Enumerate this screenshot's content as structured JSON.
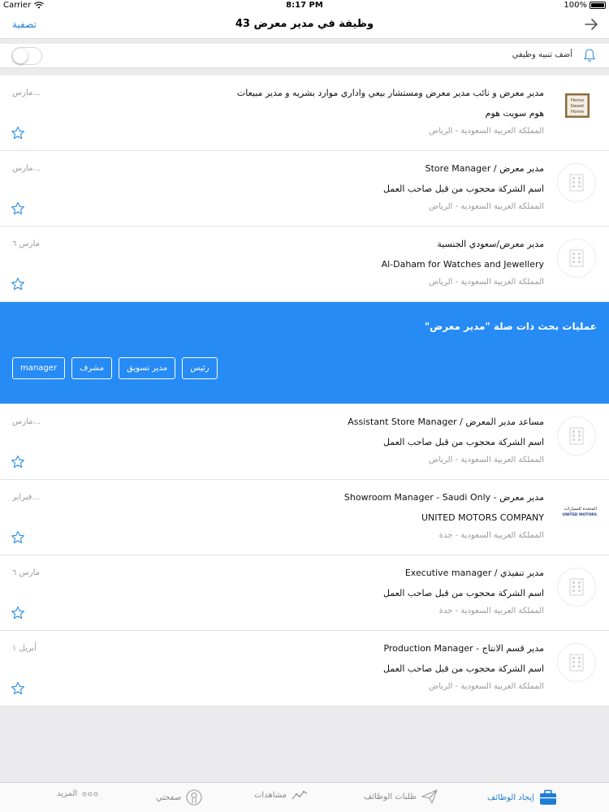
{
  "status": {
    "carrier": "Carrier",
    "time": "8:17 PM",
    "battery": "100%"
  },
  "nav": {
    "filter_label": "تصفية",
    "title": "43 وظيفة في مدير معرض"
  },
  "alert": {
    "label": "أضف تنبيه وظيفي",
    "enabled": false
  },
  "jobs_top": [
    {
      "title": "مدير معرض  و نائب مدير معرض  ومستشار بيعي  واداري موارد بشريه و مدير مبيعات",
      "company": "هوم سويت هوم",
      "location": "المملكة العربية السعودية - الرياض",
      "date": "مارس...",
      "logo": "home-sweet-home-logo"
    },
    {
      "title": "مدير معرض / Store Manager",
      "company": "اسم الشركة محجوب من قبل صاحب العمل",
      "location": "المملكة العربية السعودية - الرياض",
      "date": "مارس...",
      "logo": "building-placeholder-icon"
    },
    {
      "title": "مدير معرض/سعودي الجنسية",
      "company": "Al-Daham for Watches and Jewellery",
      "location": "المملكة العربية السعودية - الرياض",
      "date": "مارس ٦",
      "logo": "building-placeholder-icon"
    }
  ],
  "related": {
    "title": "عمليات بحث ذات صلة \"مدير معرض\"",
    "chips": [
      "manager",
      "مشرف",
      "مدير تسويق",
      "رئيس"
    ]
  },
  "jobs_bottom": [
    {
      "title": "مساعد مدير المعرض / Assistant Store Manager",
      "company": "اسم الشركة محجوب من قبل صاحب العمل",
      "location": "المملكة العربية السعودية - الرياض",
      "date": "مارس...",
      "logo": "building-placeholder-icon"
    },
    {
      "title": "مدير معرض - Showroom Manager - Saudi Only",
      "company": "UNITED MOTORS COMPANY",
      "location": "المملكة العربية السعودية - جدة",
      "date": "فبراير...",
      "logo": "united-motors-logo"
    },
    {
      "title": "مدير تنفيذي / Executive manager",
      "company": "اسم الشركة محجوب من قبل صاحب العمل",
      "location": "المملكة العربية السعودية - جدة",
      "date": "مارس ٦",
      "logo": "building-placeholder-icon"
    },
    {
      "title": "مدير قسم الانتاج - Production Manager",
      "company": "اسم الشركة محجوب من قبل صاحب العمل",
      "location": "المملكة العربية السعودية - الرياض",
      "date": "أبريل ١",
      "logo": "building-placeholder-icon"
    }
  ],
  "logos": {
    "home_sweet_home": [
      "Home",
      "Sweet",
      "Home"
    ],
    "united_motors": [
      "المتحدة للسيارات",
      "UNITED MOTORS"
    ]
  },
  "tabs": [
    {
      "label": "إيجاد الوظائف",
      "icon": "briefcase-icon",
      "active": true
    },
    {
      "label": "طلبات الوظائف",
      "icon": "paper-plane-icon",
      "active": false
    },
    {
      "label": "مشاهدات",
      "icon": "trend-icon",
      "active": false
    },
    {
      "label": "صفحتي",
      "icon": "profile-icon",
      "active": false
    },
    {
      "label": "المزيد",
      "icon": "more-dots-icon",
      "active": false
    }
  ],
  "colors": {
    "accent": "#1f7dd6",
    "related_bg": "#268bf5",
    "muted": "#9a9a9a"
  }
}
